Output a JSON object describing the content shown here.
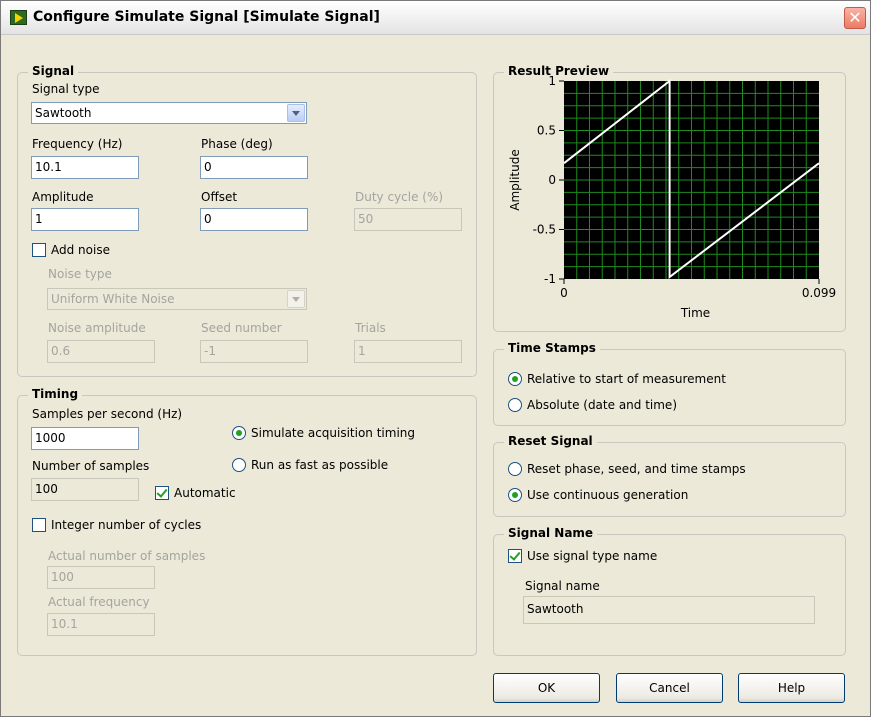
{
  "window": {
    "title": "Configure Simulate Signal [Simulate Signal]"
  },
  "signal": {
    "group_title": "Signal",
    "signal_type_label": "Signal type",
    "signal_type_value": "Sawtooth",
    "frequency_label": "Frequency (Hz)",
    "frequency_value": "10.1",
    "phase_label": "Phase (deg)",
    "phase_value": "0",
    "amplitude_label": "Amplitude",
    "amplitude_value": "1",
    "offset_label": "Offset",
    "offset_value": "0",
    "duty_label": "Duty cycle (%)",
    "duty_value": "50",
    "add_noise_label": "Add noise",
    "add_noise_checked": false,
    "noise_type_label": "Noise type",
    "noise_type_value": "Uniform White Noise",
    "noise_amplitude_label": "Noise amplitude",
    "noise_amplitude_value": "0.6",
    "seed_label": "Seed number",
    "seed_value": "-1",
    "trials_label": "Trials",
    "trials_value": "1"
  },
  "timing": {
    "group_title": "Timing",
    "sps_label": "Samples per second (Hz)",
    "sps_value": "1000",
    "simulate_label": "Simulate acquisition timing",
    "fast_label": "Run as fast as possible",
    "selected": "simulate",
    "num_samples_label": "Number of samples",
    "num_samples_value": "100",
    "automatic_label": "Automatic",
    "automatic_checked": true,
    "integer_cycles_label": "Integer number of cycles",
    "integer_cycles_checked": false,
    "actual_samples_label": "Actual number of samples",
    "actual_samples_value": "100",
    "actual_freq_label": "Actual frequency",
    "actual_freq_value": "10.1"
  },
  "preview": {
    "group_title": "Result Preview"
  },
  "chart_data": {
    "type": "line",
    "title": "",
    "xlabel": "Time",
    "ylabel": "Amplitude",
    "xlim": [
      0,
      0.099
    ],
    "ylim": [
      -1,
      1
    ],
    "x_ticks": [
      "0",
      "0.099"
    ],
    "y_ticks": [
      "1",
      "0.5",
      "0",
      "-0.5",
      "-1"
    ],
    "grid": true,
    "background": "#000000",
    "grid_color": "#1f8a1f",
    "line_color": "#ffffff",
    "series": [
      {
        "x": [
          0,
          0.041,
          0.041,
          0.099
        ],
        "y": [
          0.17,
          1.0,
          -0.98,
          0.17
        ]
      }
    ]
  },
  "timestamps": {
    "group_title": "Time Stamps",
    "relative_label": "Relative to start of measurement",
    "absolute_label": "Absolute (date and time)",
    "selected": "relative"
  },
  "reset": {
    "group_title": "Reset Signal",
    "reset_label": "Reset phase, seed, and time stamps",
    "continuous_label": "Use continuous generation",
    "selected": "continuous"
  },
  "signal_name": {
    "group_title": "Signal Name",
    "use_type_name_label": "Use signal type name",
    "use_type_name_checked": true,
    "name_label": "Signal name",
    "name_value": "Sawtooth"
  },
  "buttons": {
    "ok": "OK",
    "cancel": "Cancel",
    "help": "Help"
  }
}
